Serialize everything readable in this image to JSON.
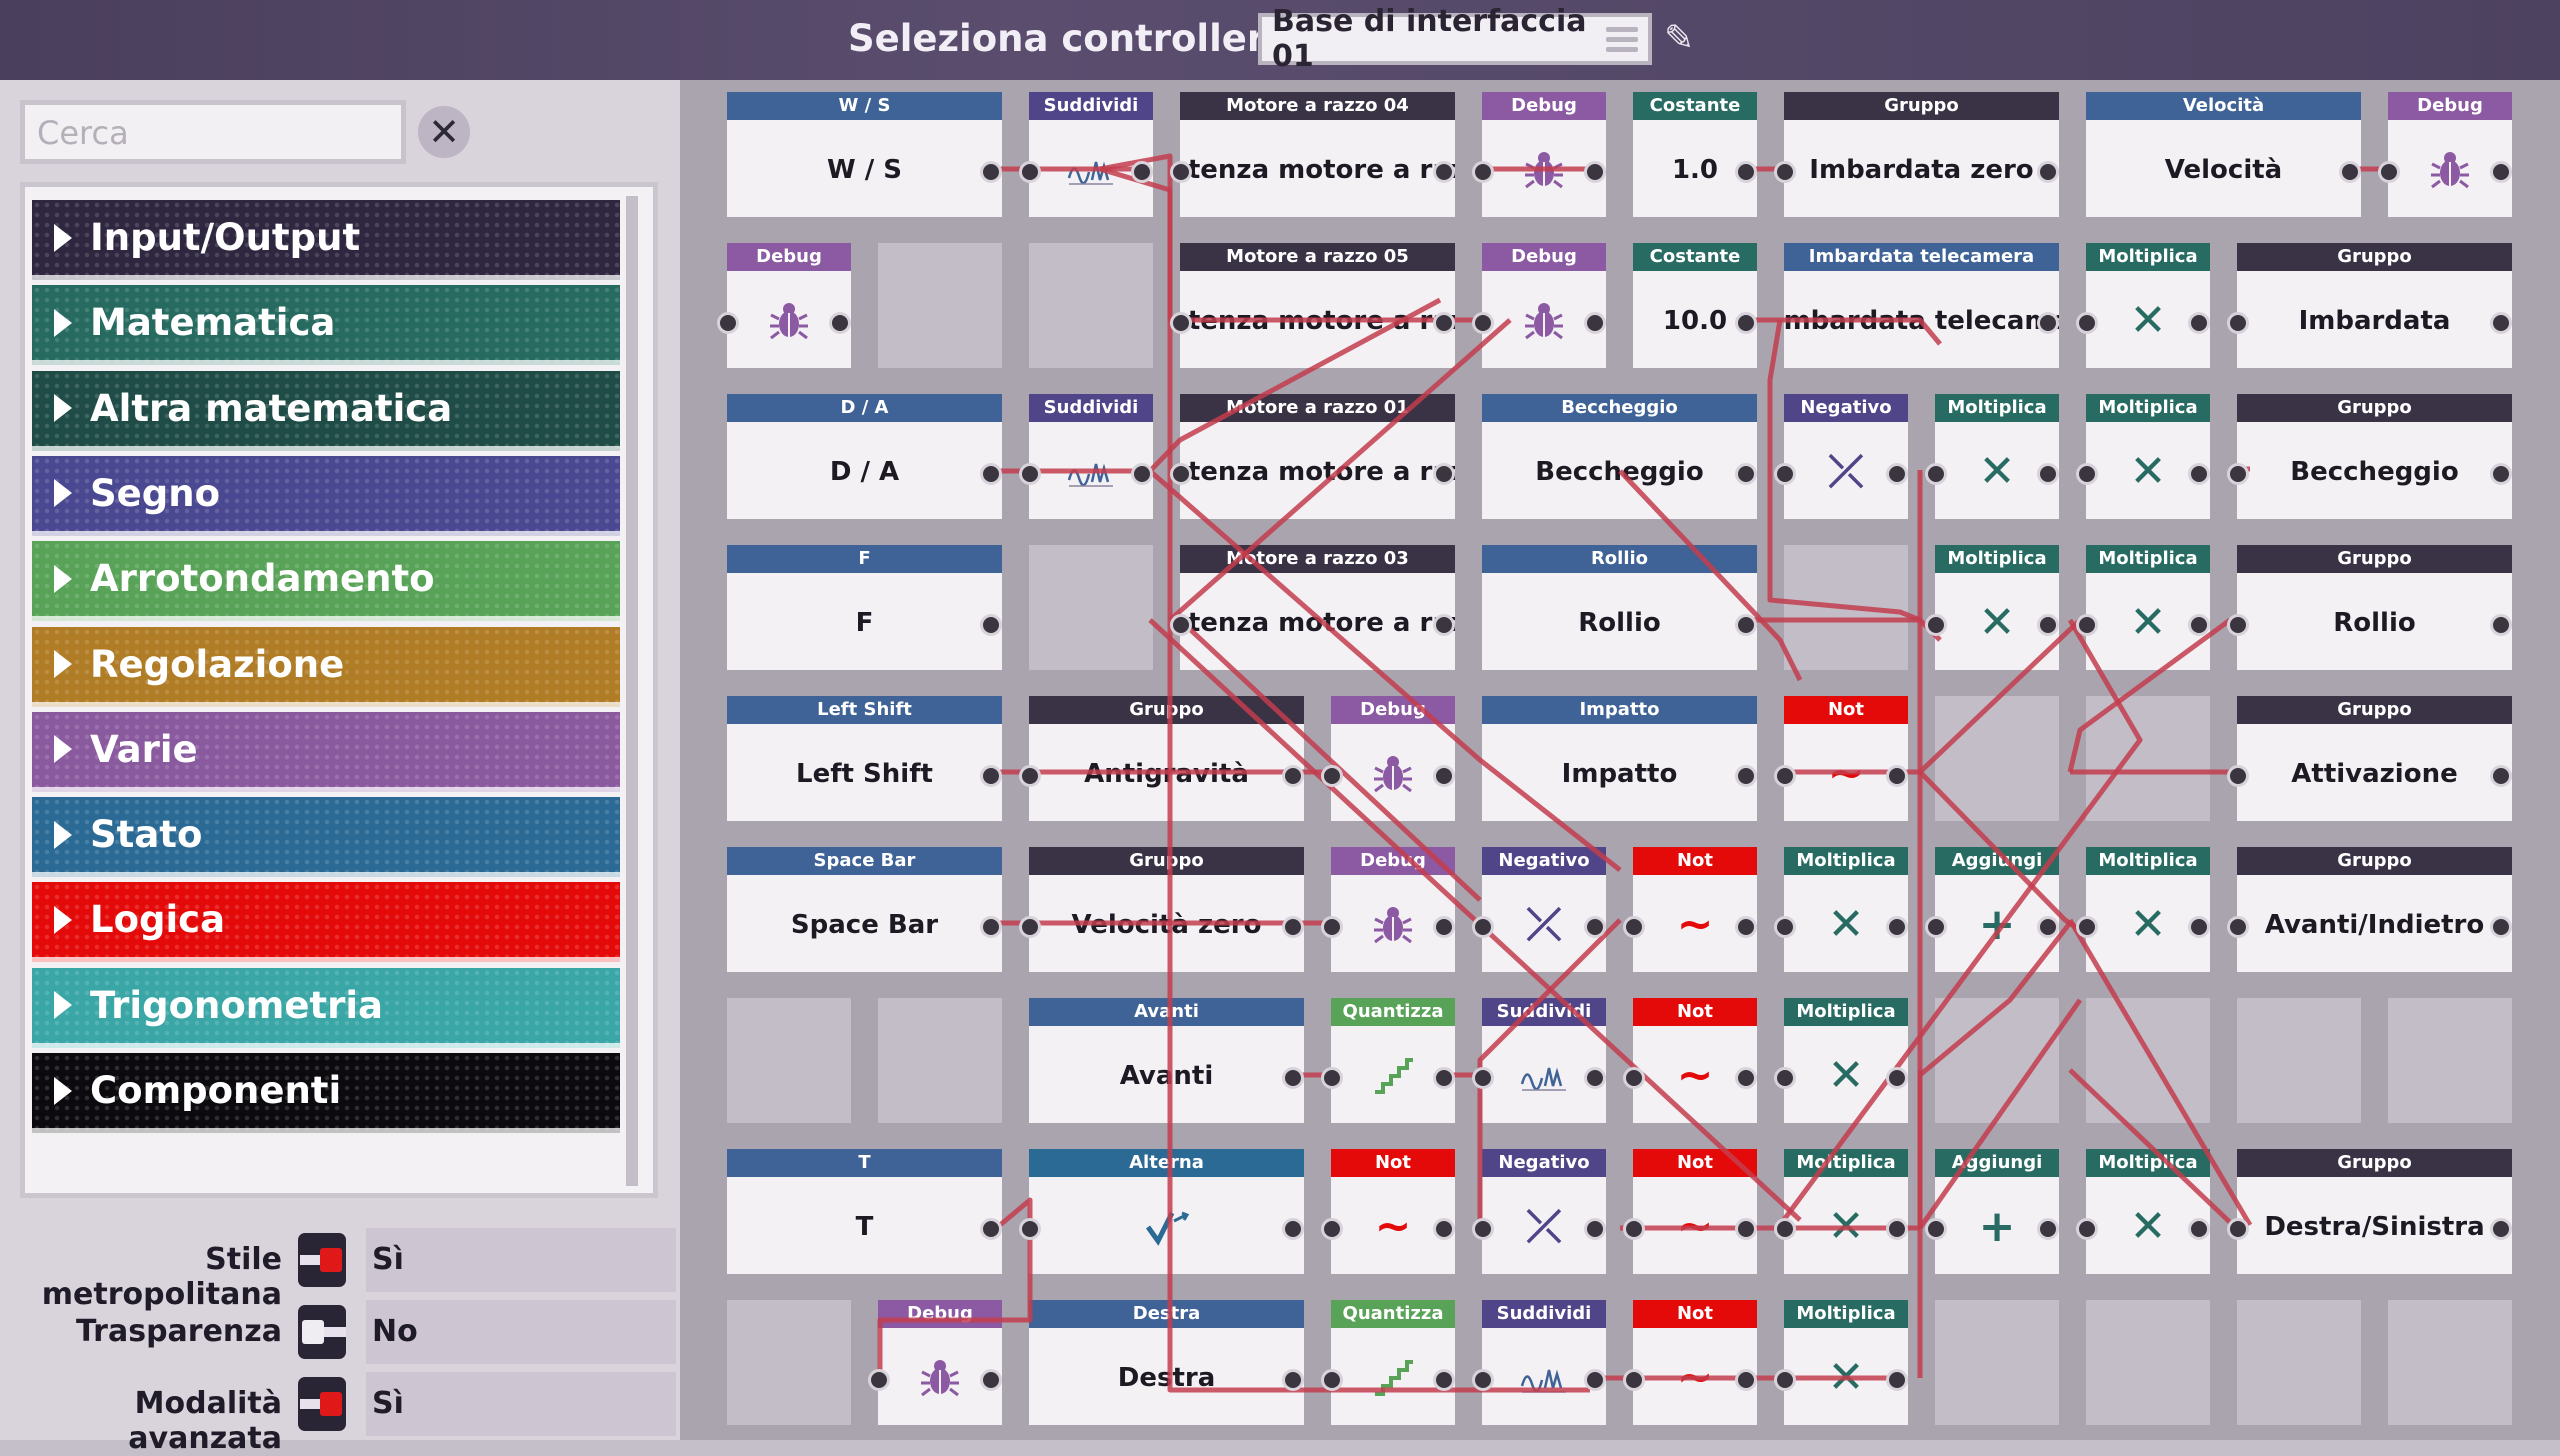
{
  "header": {
    "title": "Seleziona controller:",
    "controller": "Base di interfaccia 01"
  },
  "search": {
    "placeholder": "Cerca"
  },
  "categories": [
    {
      "label": "Input/Output",
      "color": "#2f2640"
    },
    {
      "label": "Matematica",
      "color": "#276b60"
    },
    {
      "label": "Altra matematica",
      "color": "#1f4c47"
    },
    {
      "label": "Segno",
      "color": "#4a4890"
    },
    {
      "label": "Arrotondamento",
      "color": "#58a358"
    },
    {
      "label": "Regolazione",
      "color": "#b07c25"
    },
    {
      "label": "Varie",
      "color": "#8a5a9f"
    },
    {
      "label": "Stato",
      "color": "#2b6a94"
    },
    {
      "label": "Logica",
      "color": "#e50a0a"
    },
    {
      "label": "Trigonometria",
      "color": "#3aa6a6"
    },
    {
      "label": "Componenti",
      "color": "#0c0a0e"
    }
  ],
  "options": [
    {
      "label": "Stile metropolitana",
      "value": "Sì",
      "on": true
    },
    {
      "label": "Trasparenza",
      "value": "No",
      "on": false
    },
    {
      "label": "Modalità avanzata",
      "value": "Sì",
      "on": true
    }
  ],
  "nodes": [
    {
      "h": "W / S",
      "b": "W / S",
      "c": "#3f6396"
    },
    {
      "h": "Suddividi",
      "b": "",
      "c": "#4f4588"
    },
    {
      "h": "Motore a razzo 04",
      "b": "otenza motore a raz",
      "c": "#3a3245"
    },
    {
      "h": "Debug",
      "b": "",
      "c": "#8c5aa3"
    },
    {
      "h": "Costante",
      "b": "1.0",
      "c": "#286b62"
    },
    {
      "h": "Gruppo",
      "b": "Imbardata zero",
      "c": "#3a3245"
    },
    {
      "h": "Velocità",
      "b": "Velocità",
      "c": "#3f6396"
    },
    {
      "h": "Debug",
      "b": "",
      "c": "#8c5aa3"
    },
    {
      "h": "Debug",
      "b": "",
      "c": "#8c5aa3"
    },
    {
      "h": "Motore a razzo 05",
      "b": "otenza motore a raz",
      "c": "#3a3245"
    },
    {
      "h": "Debug",
      "b": "",
      "c": "#8c5aa3"
    },
    {
      "h": "Costante",
      "b": "10.0",
      "c": "#286b62"
    },
    {
      "h": "Imbardata telecamera",
      "b": "Imbardata telecame",
      "c": "#3f6396"
    },
    {
      "h": "Moltiplica",
      "b": "✕",
      "c": "#286b62"
    },
    {
      "h": "Gruppo",
      "b": "Imbardata",
      "c": "#3a3245"
    },
    {
      "h": "D / A",
      "b": "D / A",
      "c": "#3f6396"
    },
    {
      "h": "Suddividi",
      "b": "",
      "c": "#4f4588"
    },
    {
      "h": "Motore a razzo 01",
      "b": "otenza motore a raz",
      "c": "#3a3245"
    },
    {
      "h": "Beccheggio",
      "b": "Beccheggio",
      "c": "#3f6396"
    },
    {
      "h": "Negativo",
      "b": "⤫",
      "c": "#4f4588"
    },
    {
      "h": "Moltiplica",
      "b": "✕",
      "c": "#286b62"
    },
    {
      "h": "Moltiplica",
      "b": "✕",
      "c": "#286b62"
    },
    {
      "h": "Gruppo",
      "b": "Beccheggio",
      "c": "#3a3245"
    },
    {
      "h": "F",
      "b": "F",
      "c": "#3f6396"
    },
    {
      "h": "Motore a razzo 03",
      "b": "otenza motore a raz",
      "c": "#3a3245"
    },
    {
      "h": "Rollio",
      "b": "Rollio",
      "c": "#3f6396"
    },
    {
      "h": "Moltiplica",
      "b": "✕",
      "c": "#286b62"
    },
    {
      "h": "Moltiplica",
      "b": "✕",
      "c": "#286b62"
    },
    {
      "h": "Gruppo",
      "b": "Rollio",
      "c": "#3a3245"
    },
    {
      "h": "Left Shift",
      "b": "Left Shift",
      "c": "#3f6396"
    },
    {
      "h": "Gruppo",
      "b": "Antigravità",
      "c": "#3a3245"
    },
    {
      "h": "Debug",
      "b": "",
      "c": "#8c5aa3"
    },
    {
      "h": "Impatto",
      "b": "Impatto",
      "c": "#3f6396"
    },
    {
      "h": "Not",
      "b": "~",
      "c": "#e50a0a"
    },
    {
      "h": "Gruppo",
      "b": "Attivazione",
      "c": "#3a3245"
    },
    {
      "h": "Space Bar",
      "b": "Space Bar",
      "c": "#3f6396"
    },
    {
      "h": "Gruppo",
      "b": "Velocità zero",
      "c": "#3a3245"
    },
    {
      "h": "Debug",
      "b": "",
      "c": "#8c5aa3"
    },
    {
      "h": "Negativo",
      "b": "⤫",
      "c": "#4f4588"
    },
    {
      "h": "Not",
      "b": "~",
      "c": "#e50a0a"
    },
    {
      "h": "Moltiplica",
      "b": "✕",
      "c": "#286b62"
    },
    {
      "h": "Aggiungi",
      "b": "+",
      "c": "#286b62"
    },
    {
      "h": "Moltiplica",
      "b": "✕",
      "c": "#286b62"
    },
    {
      "h": "Gruppo",
      "b": "Avanti/Indietro",
      "c": "#3a3245"
    },
    {
      "h": "Avanti",
      "b": "Avanti",
      "c": "#3f6396"
    },
    {
      "h": "Quantizza",
      "b": "",
      "c": "#58a358"
    },
    {
      "h": "Suddividi",
      "b": "",
      "c": "#4f4588"
    },
    {
      "h": "Not",
      "b": "~",
      "c": "#e50a0a"
    },
    {
      "h": "Moltiplica",
      "b": "✕",
      "c": "#286b62"
    },
    {
      "h": "T",
      "b": "T",
      "c": "#3f6396"
    },
    {
      "h": "Alterna",
      "b": "",
      "c": "#2b6a94"
    },
    {
      "h": "Not",
      "b": "~",
      "c": "#e50a0a"
    },
    {
      "h": "Negativo",
      "b": "⤫",
      "c": "#4f4588"
    },
    {
      "h": "Not",
      "b": "~",
      "c": "#e50a0a"
    },
    {
      "h": "Moltiplica",
      "b": "✕",
      "c": "#286b62"
    },
    {
      "h": "Aggiungi",
      "b": "+",
      "c": "#286b62"
    },
    {
      "h": "Moltiplica",
      "b": "✕",
      "c": "#286b62"
    },
    {
      "h": "Gruppo",
      "b": "Destra/Sinistra",
      "c": "#3a3245"
    },
    {
      "h": "Debug",
      "b": "",
      "c": "#8c5aa3"
    },
    {
      "h": "Destra",
      "b": "Destra",
      "c": "#3f6396"
    },
    {
      "h": "Quantizza",
      "b": "",
      "c": "#58a358"
    },
    {
      "h": "Suddividi",
      "b": "",
      "c": "#4f4588"
    },
    {
      "h": "Not",
      "b": "~",
      "c": "#e50a0a"
    },
    {
      "h": "Moltiplica",
      "b": "✕",
      "c": "#286b62"
    }
  ]
}
